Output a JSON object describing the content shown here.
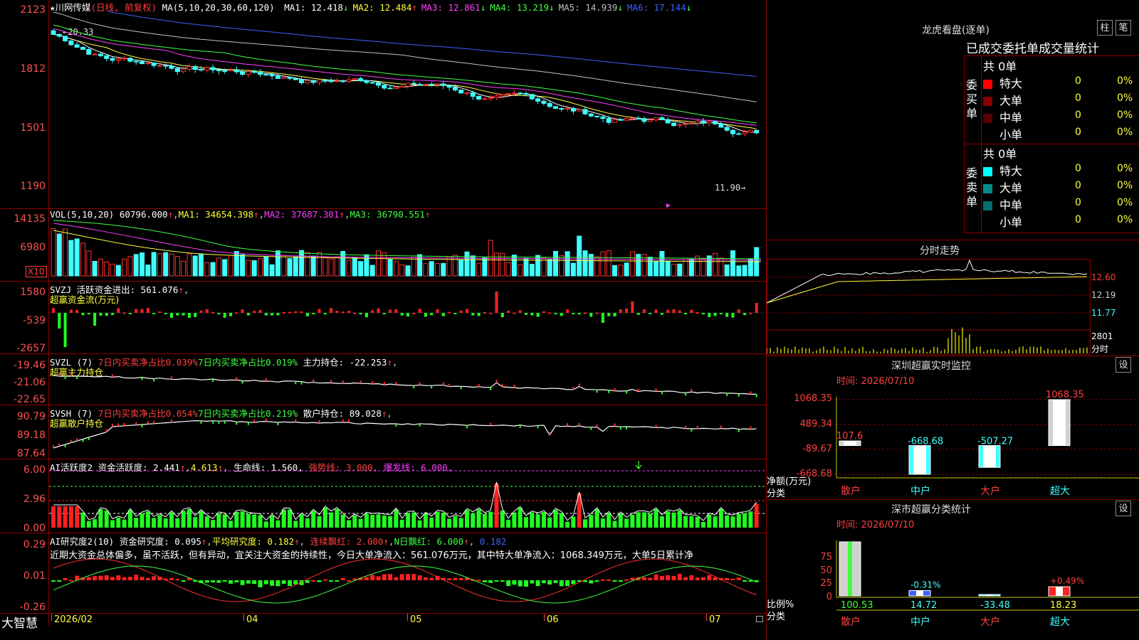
{
  "stock": {
    "name": "★川网传媒",
    "mode": "(日线, 前复权)",
    "ma_label": "MA(5,10,20,30,60,120)",
    "ma": [
      {
        "label": "MA1:",
        "value": "12.418",
        "arrow": "↓",
        "color": "#ffffff"
      },
      {
        "label": "MA2:",
        "value": "12.484",
        "arrow": "↑",
        "color": "#ffff40"
      },
      {
        "label": "MA3:",
        "value": "12.861",
        "arrow": "↓",
        "color": "#ff40ff"
      },
      {
        "label": "MA4:",
        "value": "13.219",
        "arrow": "↓",
        "color": "#40ff40"
      },
      {
        "label": "MA5:",
        "value": "14.939",
        "arrow": "↓",
        "color": "#c0c0c0"
      },
      {
        "label": "MA6:",
        "value": "17.144",
        "arrow": "↓",
        "color": "#4060ff"
      }
    ],
    "price_axis": [
      "2123",
      "1812",
      "1501",
      "1190"
    ],
    "high_label": "20.33",
    "low_label": "11.90"
  },
  "volume": {
    "label": "VOL(5,10,20)",
    "value": "60796.000",
    "ma1": "MA1: 34654.398",
    "ma2": "MA2: 37687.301",
    "ma3": "MA3: 36790.551",
    "axis": [
      "14135",
      "6980"
    ],
    "unit": "X10"
  },
  "svzj": {
    "label": "SVZJ  活跃资金进出: 561.076",
    "sub": "超赢资金流(万元)",
    "axis": [
      "1580",
      "-539",
      "-2657"
    ]
  },
  "svzl": {
    "label": "SVZL (7)",
    "part1": "7日内买卖净占比0.039%",
    "part2": "7日内买卖净占比0.019%",
    "part3": "主力持仓: -22.253",
    "sub": "超赢主力持仓",
    "axis": [
      "-19.46",
      "-21.06",
      "-22.65"
    ]
  },
  "svsh": {
    "label": "SVSH (7)",
    "part1": "7日内买卖净占比0.054%",
    "part2": "7日内买卖净占比0.219%",
    "part3": "散户持仓: 89.028",
    "sub": "超赢散户持仓",
    "axis": [
      "90.79",
      "89.18",
      "87.64"
    ]
  },
  "ai_activity": {
    "label": "AI活跃度2 资金活跃度: 2.441",
    "v2": "4.613",
    "v3": "生命线: 1.560,",
    "v4": "强势线: 3.000,",
    "v5": "爆发线: 6.000,",
    "axis": [
      "6.00",
      "2.96",
      "0.00"
    ]
  },
  "ai_research": {
    "label": "AI研究度2(10) 资金研究度: 0.095",
    "v2": "平均研究度: 0.182",
    "v3": "连续飘红: 2.000",
    "v4": "N日飘红: 6.000",
    "v5": "0.182",
    "commentary": "近期大资金总体偏多，虽不活跃，但有异动，宜关注大资金的持续性，今日大单净流入：561.076万元，其中特大单净流入：1068.349万元，大单5日累计净",
    "axis": [
      "0.29",
      "0.01",
      "-0.26"
    ]
  },
  "time_axis": [
    "2026/02",
    "04",
    "05",
    "06",
    "07"
  ],
  "brand": "大智慧",
  "right_panel": {
    "dragon_title": "龙虎看盘(逐单)",
    "btn_zhu": "柱",
    "btn_bi": "笔",
    "table_title": "已成交委托单成交量统计",
    "buy_group": "委买单",
    "sell_group": "委卖单",
    "buy_total": "共 0单",
    "sell_total": "共 0单",
    "buy_rows": [
      {
        "label": "特大",
        "count": "0",
        "pct": "0%",
        "color": "#ff0000"
      },
      {
        "label": "大单",
        "count": "0",
        "pct": "0%",
        "color": "#8b0000"
      },
      {
        "label": "中单",
        "count": "0",
        "pct": "0%",
        "color": "#5a0000"
      },
      {
        "label": "小单",
        "count": "0",
        "pct": "0%",
        "color": "#000000"
      }
    ],
    "sell_rows": [
      {
        "label": "特大",
        "count": "0",
        "pct": "0%",
        "color": "#00ffff"
      },
      {
        "label": "大单",
        "count": "0",
        "pct": "0%",
        "color": "#008b8b"
      },
      {
        "label": "中单",
        "count": "0",
        "pct": "0%",
        "color": "#007070"
      },
      {
        "label": "小单",
        "count": "0",
        "pct": "0%",
        "color": "#000000"
      }
    ],
    "intraday_title": "分时走势",
    "intraday_axis": [
      "12.60",
      "12.19",
      "11.77",
      "2801",
      "分时"
    ],
    "monitor_title": "深圳超赢实时监控",
    "monitor_btn": "设",
    "monitor_time": "时间: 2026/07/10",
    "monitor_axis": [
      "1068.35",
      "489.34",
      "-89.67",
      "-668.68"
    ],
    "monitor_ylabel": "净额(万元)",
    "monitor_xlabel": "分类",
    "monitor_bars": [
      {
        "name": "散户",
        "value": "107.6"
      },
      {
        "name": "中户",
        "value": "-668.68"
      },
      {
        "name": "大户",
        "value": "-507.27"
      },
      {
        "name": "超大",
        "value": "1068.35"
      }
    ],
    "stats_title": "深市超赢分类统计",
    "stats_btn": "设",
    "stats_time": "时间: 2026/07/10",
    "stats_axis": [
      "75",
      "50",
      "25",
      "0"
    ],
    "stats_ylabel": "比例%",
    "stats_xlabel": "分类",
    "stats_bars": [
      {
        "name": "散户",
        "value": "100.53",
        "pct": ""
      },
      {
        "name": "中户",
        "value": "14.72",
        "pct": "-0.31%"
      },
      {
        "name": "大户",
        "value": "-33.48",
        "pct": ""
      },
      {
        "name": "超大",
        "value": "18.23",
        "pct": "+0.49%"
      }
    ]
  }
}
